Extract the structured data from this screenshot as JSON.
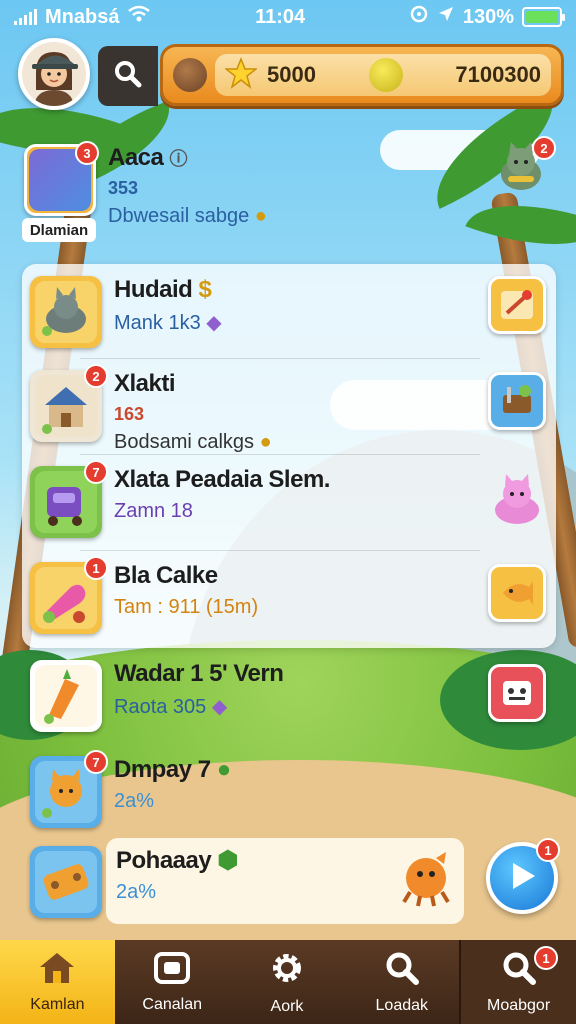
{
  "status_bar": {
    "carrier": "Mnabsá",
    "time": "11:04",
    "battery": "130%"
  },
  "resources": {
    "stars": "5000",
    "gems": "7100300"
  },
  "header_item": {
    "name": "Aaca",
    "count": "353",
    "desc": "Dbwesail sabge",
    "ribbon": "Dlamian",
    "badge": "3"
  },
  "side_badge_top": "2",
  "panel_items": [
    {
      "name": "Hudaid",
      "name_extra": "$",
      "sub": "Mank 1k3",
      "badge": ""
    },
    {
      "name": "Xlakti",
      "sub": "163",
      "desc": "Bodsami calkgs",
      "badge": "2"
    },
    {
      "name": "Xlata Peadaia Slem.",
      "sub": "Zamn 18",
      "badge": "7"
    },
    {
      "name": "Bla Calke",
      "sub": "Tam : 911 (15m)",
      "badge": "1"
    }
  ],
  "lower_items": [
    {
      "name": "Wadar 1 5' Vern",
      "sub": "Raota  305",
      "badge": ""
    },
    {
      "name": "Dmpay 7",
      "sub": "2a%",
      "badge": "7"
    },
    {
      "name": "Pohaaay",
      "sub": "2a%",
      "badge": ""
    }
  ],
  "play_badge": "1",
  "nav": [
    {
      "label": "Kamlan",
      "icon": "home-icon"
    },
    {
      "label": "Canalan",
      "icon": "camera-icon"
    },
    {
      "label": "Aork",
      "icon": "gear-icon"
    },
    {
      "label": "Loadak",
      "icon": "search-icon"
    },
    {
      "label": "Moabgor",
      "icon": "magnifier-icon",
      "badge": "1"
    }
  ],
  "colors": {
    "accent_orange": "#e98a1e",
    "badge_red": "#e43d2f",
    "nav_brown": "#4a2f1c",
    "nav_active": "#f3b417"
  }
}
